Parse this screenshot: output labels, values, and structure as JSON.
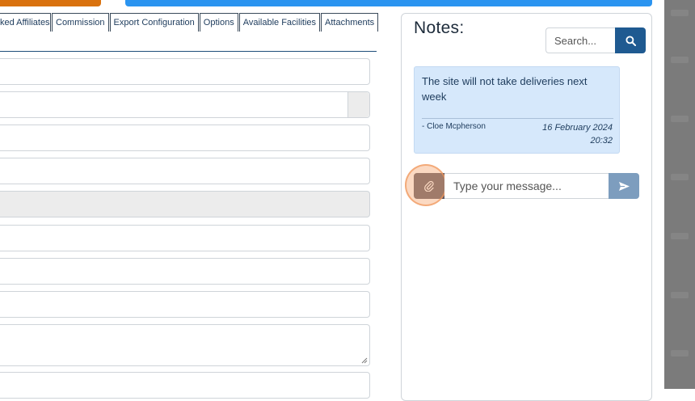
{
  "tabs": [
    {
      "label": "ked Affiliates"
    },
    {
      "label": "Commission"
    },
    {
      "label": "Export Configuration"
    },
    {
      "label": "Options"
    },
    {
      "label": "Available Facilities"
    },
    {
      "label": "Attachments"
    }
  ],
  "notes": {
    "title": "Notes:",
    "search_placeholder": "Search...",
    "entries": [
      {
        "text": "The site will not take deliveries next week",
        "author": "- Cloe Mcpherson",
        "date": "16 February 2024",
        "time": "20:32"
      }
    ],
    "message_placeholder": "Type your message..."
  },
  "colors": {
    "accent_orange": "#d9720f",
    "accent_blue": "#2b94f0",
    "search_button": "#1f5a91",
    "note_bg": "#d6e8fb",
    "send_button": "#7d9dbe"
  },
  "icons": {
    "search": "search-icon",
    "attach": "paperclip-icon",
    "send": "paper-plane-icon"
  }
}
